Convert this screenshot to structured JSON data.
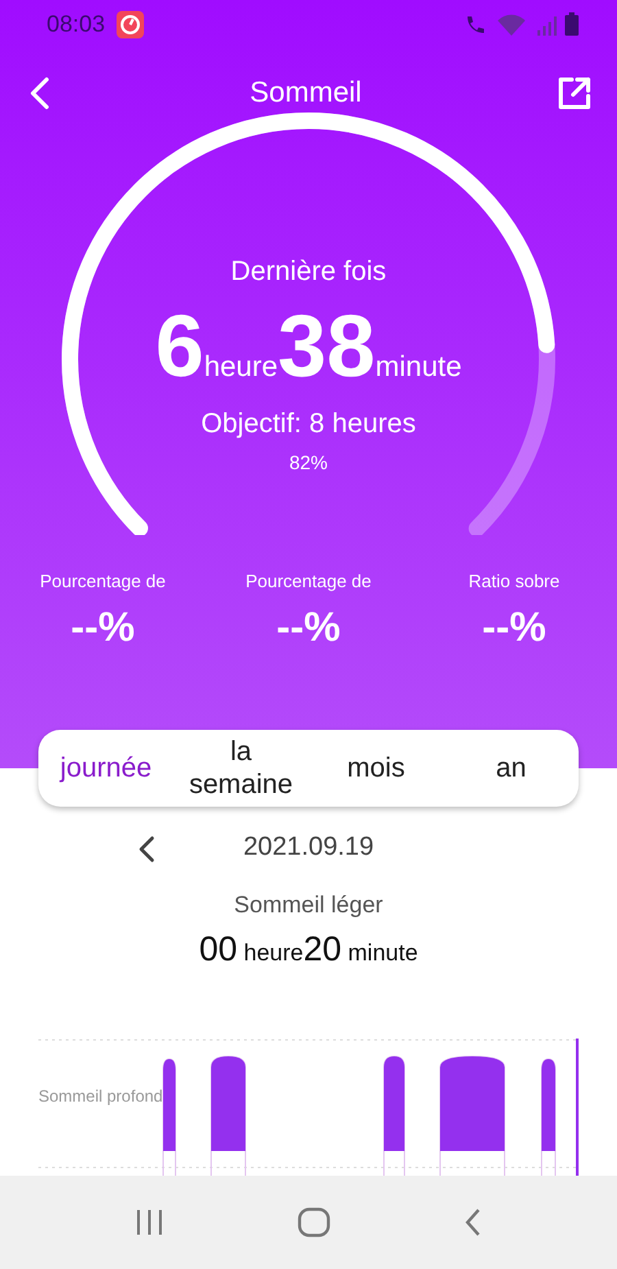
{
  "status_bar": {
    "time": "08:03"
  },
  "header": {
    "title": "Sommeil"
  },
  "gauge": {
    "label": "Dernière fois",
    "hours": "6",
    "hours_unit": "heure",
    "minutes": "38",
    "minutes_unit": "minute",
    "goal": "Objectif: 8 heures",
    "percent": "82%",
    "level": 0.82
  },
  "stats": [
    {
      "label": "Pourcentage de",
      "value": "--%"
    },
    {
      "label": "Pourcentage de",
      "value": "--%"
    },
    {
      "label": "Ratio sobre",
      "value": "--%"
    }
  ],
  "tabs": [
    {
      "label": "journée",
      "selected": true
    },
    {
      "label": "la semaine",
      "selected": false
    },
    {
      "label": "mois",
      "selected": false
    },
    {
      "label": "an",
      "selected": false
    }
  ],
  "date": "2021.09.19",
  "summary": {
    "title": "Sommeil léger",
    "hours": "00",
    "hours_unit": "heure",
    "minutes": "20",
    "minutes_unit": "minute"
  },
  "chart": {
    "row_label": "Sommeil profond"
  }
}
